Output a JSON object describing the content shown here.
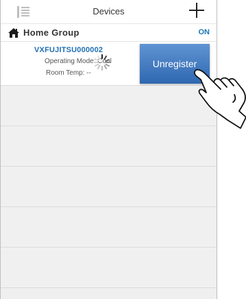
{
  "header": {
    "title": "Devices",
    "menu_icon": "menu-icon",
    "add_icon": "plus-icon"
  },
  "group": {
    "name": "Home Group",
    "status": "ON",
    "icon": "home-icon"
  },
  "device": {
    "name": "VXFUJITSU000002",
    "mode_label": "Operating Mode:",
    "mode_value": "Cool",
    "temp_label": "Room Temp:",
    "temp_value": "--",
    "loading_icon": "spinner-icon"
  },
  "actions": {
    "unregister_label": "Unregister"
  },
  "overlay": {
    "gesture_icon": "pointing-hand-icon"
  },
  "colors": {
    "accent": "#1c76b8",
    "button_top": "#5f94d3",
    "button_bottom": "#2f67b0",
    "page_bg": "#efefef"
  }
}
